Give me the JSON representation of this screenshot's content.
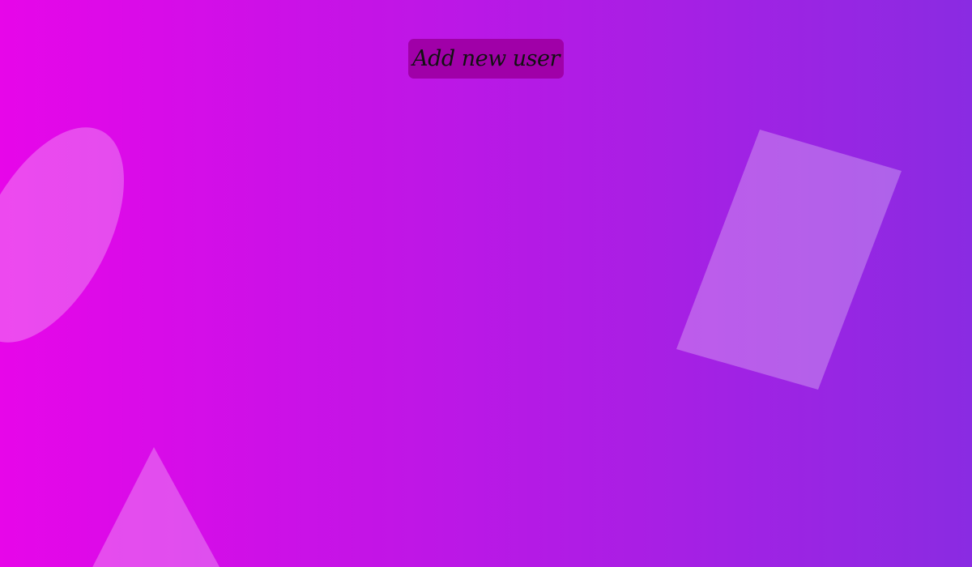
{
  "actions": {
    "add_user_label": "Add new user"
  },
  "colors": {
    "gradient_start": "#e706e9",
    "gradient_end": "#8a2be2",
    "shape_fill": "#ffffff",
    "button_bg": "#a000a8",
    "button_text": "#111111"
  }
}
